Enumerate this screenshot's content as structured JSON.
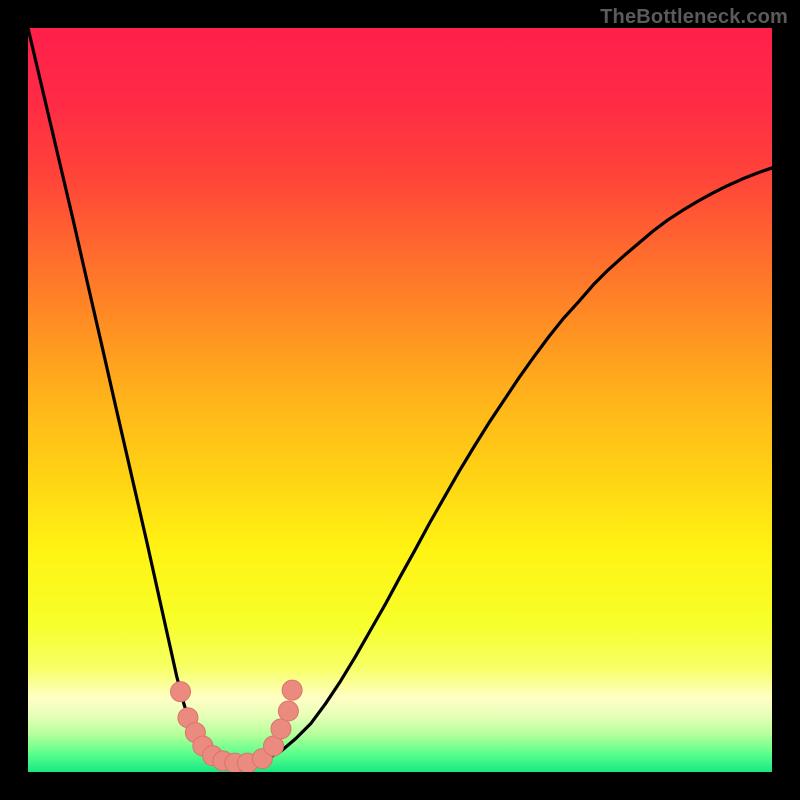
{
  "watermark": "TheBottleneck.com",
  "colors": {
    "gradient_stops": [
      {
        "offset": 0.0,
        "color": "#ff1f4b"
      },
      {
        "offset": 0.1,
        "color": "#ff2b45"
      },
      {
        "offset": 0.2,
        "color": "#ff4439"
      },
      {
        "offset": 0.3,
        "color": "#ff6a2e"
      },
      {
        "offset": 0.4,
        "color": "#ff8f23"
      },
      {
        "offset": 0.5,
        "color": "#ffb41a"
      },
      {
        "offset": 0.6,
        "color": "#ffd214"
      },
      {
        "offset": 0.7,
        "color": "#fff313"
      },
      {
        "offset": 0.8,
        "color": "#f7ff2a"
      },
      {
        "offset": 0.86,
        "color": "#f7ff66"
      },
      {
        "offset": 0.9,
        "color": "#ffffc4"
      },
      {
        "offset": 0.925,
        "color": "#e6ffb8"
      },
      {
        "offset": 0.95,
        "color": "#b3ff9a"
      },
      {
        "offset": 0.975,
        "color": "#5cff8c"
      },
      {
        "offset": 1.0,
        "color": "#18e884"
      }
    ],
    "curve": "#000000",
    "trough_marker_fill": "#eb8b80",
    "trough_marker_stroke": "#d97468"
  },
  "chart_data": {
    "type": "line",
    "title": "",
    "xlabel": "",
    "ylabel": "",
    "xlim": [
      0,
      1
    ],
    "ylim": [
      0,
      1
    ],
    "series": [
      {
        "name": "bottleneck-curve",
        "x": [
          0.0,
          0.02,
          0.04,
          0.06,
          0.08,
          0.1,
          0.12,
          0.14,
          0.16,
          0.18,
          0.2,
          0.21,
          0.22,
          0.23,
          0.24,
          0.25,
          0.26,
          0.28,
          0.3,
          0.32,
          0.34,
          0.36,
          0.38,
          0.4,
          0.42,
          0.44,
          0.46,
          0.48,
          0.5,
          0.52,
          0.54,
          0.56,
          0.58,
          0.6,
          0.62,
          0.64,
          0.66,
          0.68,
          0.7,
          0.72,
          0.74,
          0.76,
          0.78,
          0.8,
          0.82,
          0.84,
          0.86,
          0.88,
          0.9,
          0.92,
          0.94,
          0.96,
          0.98,
          1.0
        ],
        "y": [
          1.0,
          0.915,
          0.83,
          0.745,
          0.657,
          0.57,
          0.482,
          0.395,
          0.308,
          0.218,
          0.128,
          0.09,
          0.06,
          0.04,
          0.025,
          0.015,
          0.01,
          0.008,
          0.01,
          0.017,
          0.028,
          0.045,
          0.065,
          0.092,
          0.122,
          0.155,
          0.19,
          0.225,
          0.262,
          0.298,
          0.335,
          0.37,
          0.405,
          0.438,
          0.47,
          0.5,
          0.53,
          0.558,
          0.585,
          0.61,
          0.632,
          0.655,
          0.675,
          0.693,
          0.71,
          0.727,
          0.742,
          0.755,
          0.767,
          0.778,
          0.788,
          0.797,
          0.805,
          0.812
        ]
      }
    ],
    "trough_markers": {
      "x": [
        0.205,
        0.215,
        0.225,
        0.235,
        0.248,
        0.262,
        0.278,
        0.295,
        0.315,
        0.33,
        0.34,
        0.35,
        0.355
      ],
      "y": [
        0.108,
        0.073,
        0.053,
        0.035,
        0.022,
        0.015,
        0.012,
        0.012,
        0.018,
        0.035,
        0.058,
        0.082,
        0.11
      ],
      "r": 10
    }
  }
}
